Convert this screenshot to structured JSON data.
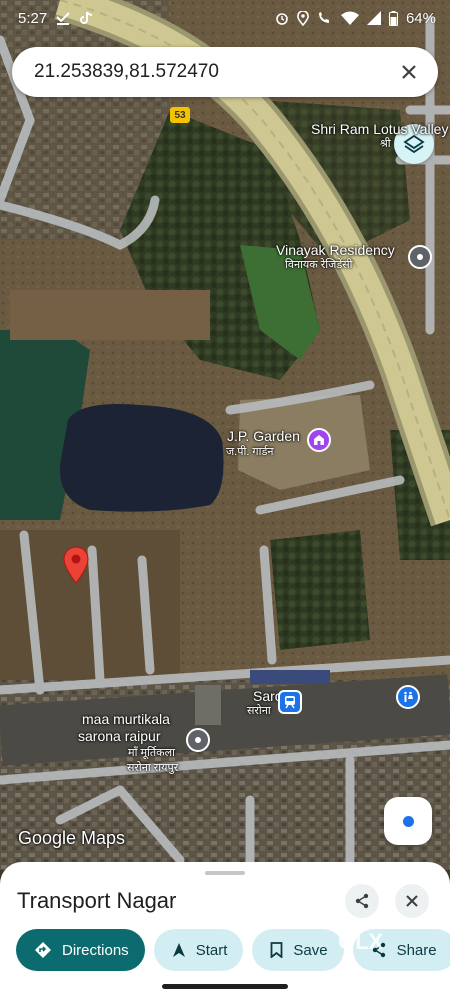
{
  "status_bar": {
    "time": "5:27",
    "battery": "64%",
    "icons": [
      "download-done-icon",
      "tiktok-icon",
      "alarm-icon",
      "location-icon",
      "wifi-call-icon",
      "wifi-icon",
      "signal-icon",
      "battery-icon"
    ]
  },
  "search": {
    "query": "21.253839,81.572470",
    "close_icon": "close-icon"
  },
  "map": {
    "road_shield": "53",
    "labels": {
      "shri_ram_en": "Shri Ram Lotus Valley",
      "shri_ram_hi": "श्री",
      "vinayak_en": "Vinayak Residency",
      "vinayak_hi": "विनायक रेजिडेंसी",
      "jp_garden_en": "J.P. Garden",
      "jp_garden_hi": "ज.पी. गार्डन",
      "sarona_en": "Sarona",
      "sarona_hi": "सरोना",
      "maa_line1": "maa murtikala",
      "maa_line2": "sarona raipur",
      "maa_hi1": "माँ मूर्तिकला",
      "maa_hi2": "सरोना रायपुर"
    },
    "colors": {
      "highway": "#c9c38a",
      "pin": "#ea4335",
      "poi_grey": "#5f6368",
      "poi_purple": "#a142f4",
      "transit": "#1a73e8"
    }
  },
  "branding": {
    "logo": "Google Maps"
  },
  "sheet": {
    "title": "Transport Nagar",
    "actions": {
      "directions": "Directions",
      "start": "Start",
      "save": "Save",
      "share": "Share"
    }
  },
  "watermark_text": "OLX"
}
